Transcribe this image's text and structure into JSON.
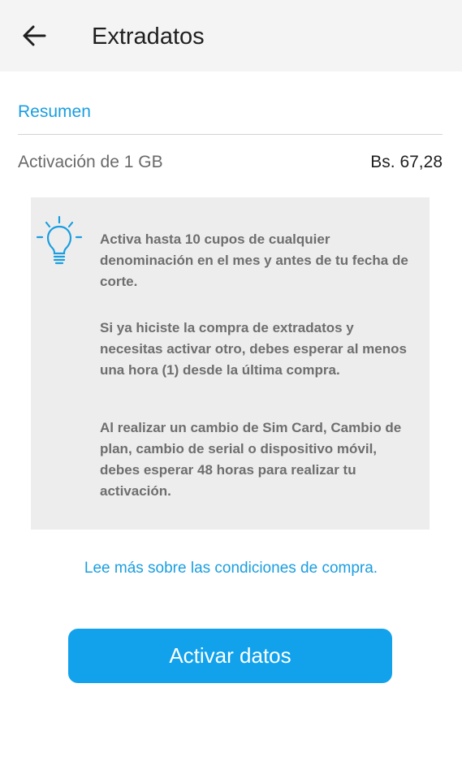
{
  "header": {
    "title": "Extradatos",
    "back_icon": "arrow-left-icon"
  },
  "summary": {
    "section_title": "Resumen",
    "item_label": "Activación de 1 GB",
    "item_price": "Bs. 67,28"
  },
  "info": {
    "icon": "lightbulb-icon",
    "icon_color": "#1a9ee0",
    "paragraphs": [
      "Activa hasta 10 cupos de cualquier denominación en el mes y antes de tu fecha de corte.",
      "Si ya hiciste la compra de extradatos y necesitas activar otro, debes esperar al menos una hora (1) desde la última compra.",
      "Al realizar un cambio de Sim Card, Cambio de plan, cambio de serial o dispositivo móvil, debes esperar 48 horas para realizar tu activación."
    ]
  },
  "link": {
    "label": "Lee más sobre las condiciones de compra."
  },
  "cta": {
    "label": "Activar datos",
    "color": "#12a2ec"
  }
}
